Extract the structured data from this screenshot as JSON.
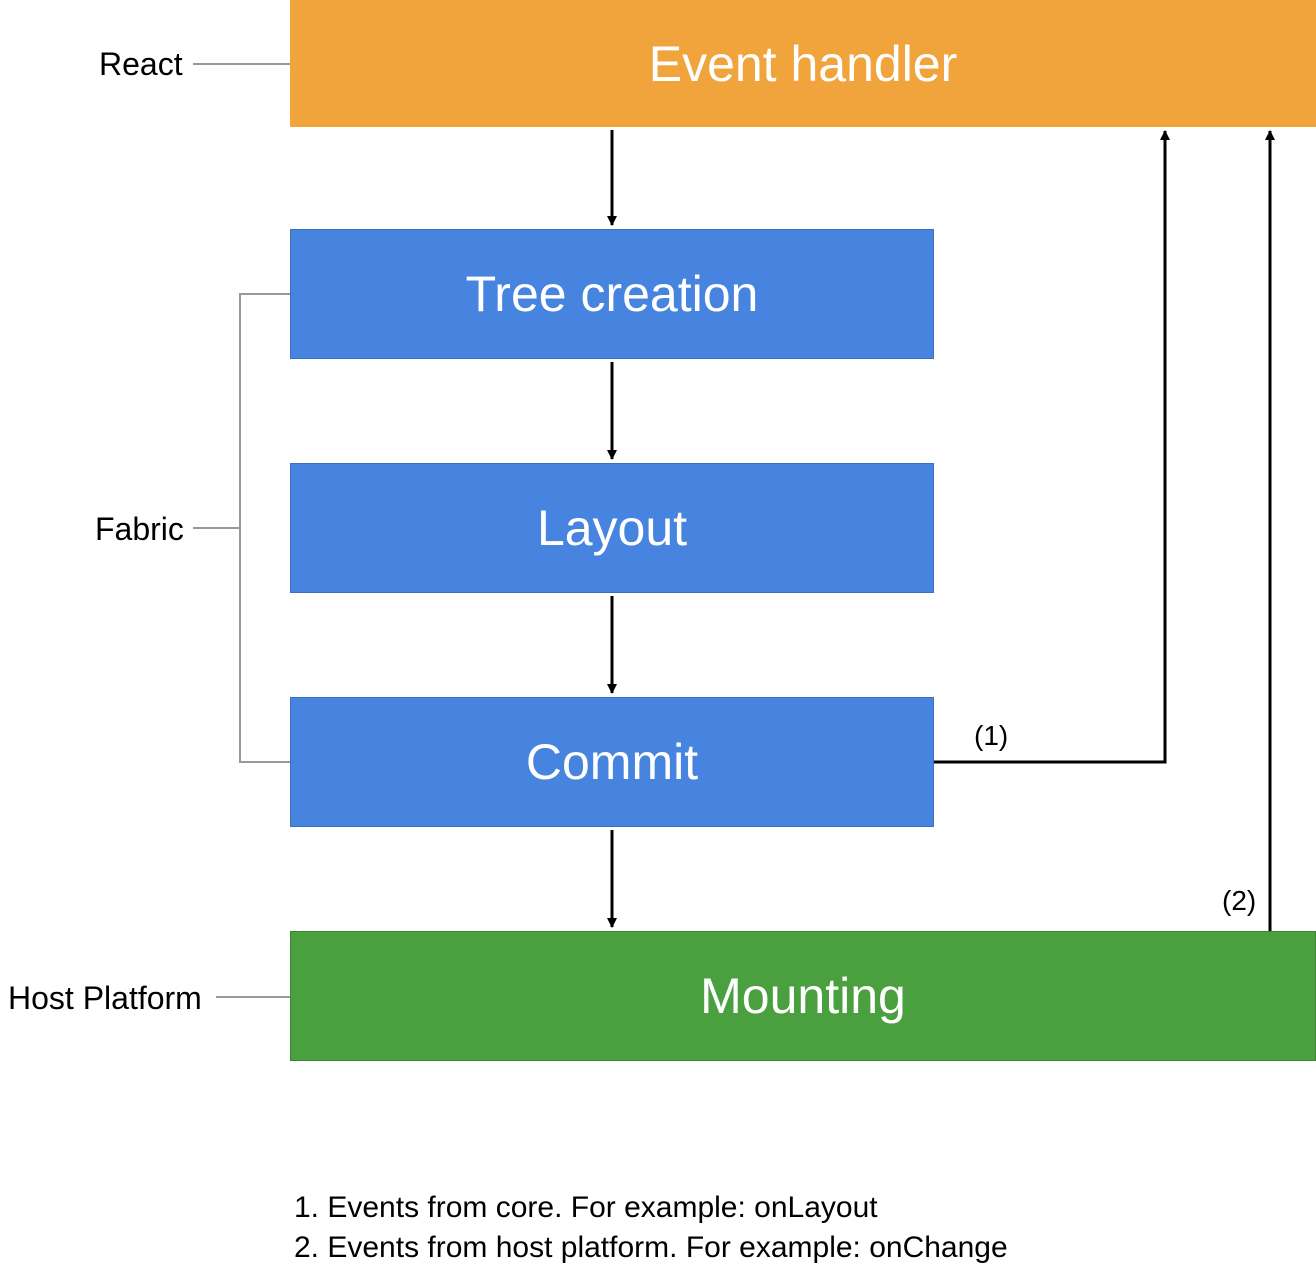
{
  "labels": {
    "react": "React",
    "fabric": "Fabric",
    "host_platform": "Host Platform"
  },
  "boxes": {
    "event_handler": "Event handler",
    "tree_creation": "Tree creation",
    "layout": "Layout",
    "commit": "Commit",
    "mounting": "Mounting"
  },
  "annotations": {
    "one": "(1)",
    "two": "(2)"
  },
  "footnotes": {
    "one": "1. Events from core. For example: onLayout",
    "two": "2. Events from host platform. For example: onChange"
  },
  "colors": {
    "orange": "#f1a33c",
    "blue": "#4784e0",
    "green": "#4a9f3e"
  }
}
